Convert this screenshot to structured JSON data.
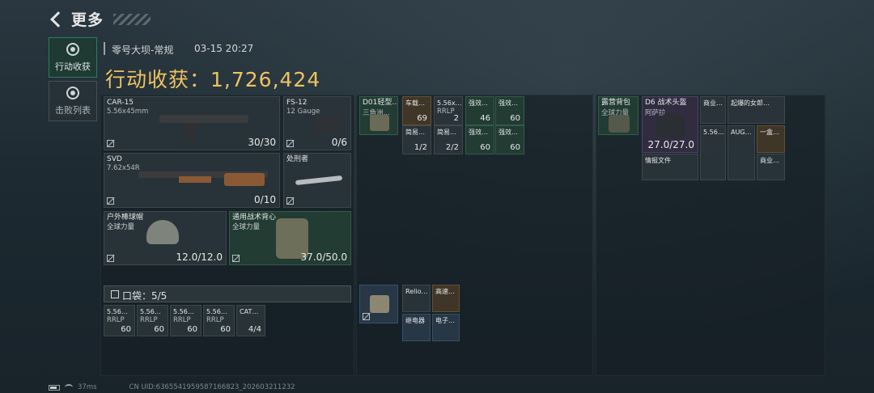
{
  "header": {
    "title": "更多"
  },
  "tabs": [
    {
      "label": "行动收获"
    },
    {
      "label": "击败列表"
    }
  ],
  "match": {
    "map": "零号大坝-常规",
    "time": "03-15 20:27",
    "harvest": "行动收获：1,726,424"
  },
  "equipment": {
    "car15": {
      "name": "CAR-15",
      "ammo": "5.56x45mm",
      "count": "30/30"
    },
    "fs12": {
      "name": "FS-12",
      "ammo": "12 Gauge",
      "count": "0/6"
    },
    "svd": {
      "name": "SVD",
      "ammo": "7.62x54R",
      "count": "0/10"
    },
    "knife": {
      "name": "处刑者"
    },
    "helmet": {
      "name": "户外棒球帽",
      "brand": "全球力量",
      "count": "12.0/12.0"
    },
    "vest": {
      "name": "通用战术背心",
      "brand": "全球力量",
      "count": "37.0/50.0"
    }
  },
  "pocket": {
    "label": "口袋：5/5",
    "items": [
      {
        "name": "5.56…",
        "sub": "RRLP",
        "count": "60"
      },
      {
        "name": "5.56…",
        "sub": "RRLP",
        "count": "60"
      },
      {
        "name": "5.56…",
        "sub": "RRLP",
        "count": "60"
      },
      {
        "name": "5.56…",
        "sub": "RRLP",
        "count": "60"
      },
      {
        "name": "CAT…",
        "sub": "",
        "count": "4/4"
      }
    ]
  },
  "rig": {
    "name": "D01轻型…",
    "sub": "三角洲…",
    "items": [
      {
        "name": "车载…",
        "count": "69"
      },
      {
        "name": "5.56x…",
        "sub": "RRLP",
        "count": "2"
      },
      {
        "name": "强效…",
        "count": "46"
      },
      {
        "name": "强效…",
        "count": "60"
      },
      {
        "name": "简易…",
        "count": "1/2"
      },
      {
        "name": "简易…",
        "count": "2/2"
      },
      {
        "name": "强效…",
        "count": "60"
      },
      {
        "name": "强效…",
        "count": "60"
      }
    ]
  },
  "case": {
    "items": [
      {
        "name": "Relio…"
      },
      {
        "name": "高速…"
      },
      {
        "name": "继电器"
      },
      {
        "name": "电子…"
      }
    ]
  },
  "backpack": {
    "name": "露营背包",
    "brand": "全球力量",
    "items": [
      {
        "name": "D6 战术头盔",
        "sub": "阿萨拉",
        "count": "27.0/27.0"
      },
      {
        "name": "商业…"
      },
      {
        "name": "起爆的女郎…"
      },
      {
        "name": "5.56…"
      },
      {
        "name": "AUG…"
      },
      {
        "name": "一盒…"
      },
      {
        "name": "商业…"
      },
      {
        "name": "情报文件"
      }
    ]
  },
  "footer": {
    "ping": "37ms",
    "uid": "CN UID:6365541959587166823_202603211232"
  },
  "colors": {
    "harvest": "#f0c261",
    "active_tab": "#1e3a33"
  }
}
